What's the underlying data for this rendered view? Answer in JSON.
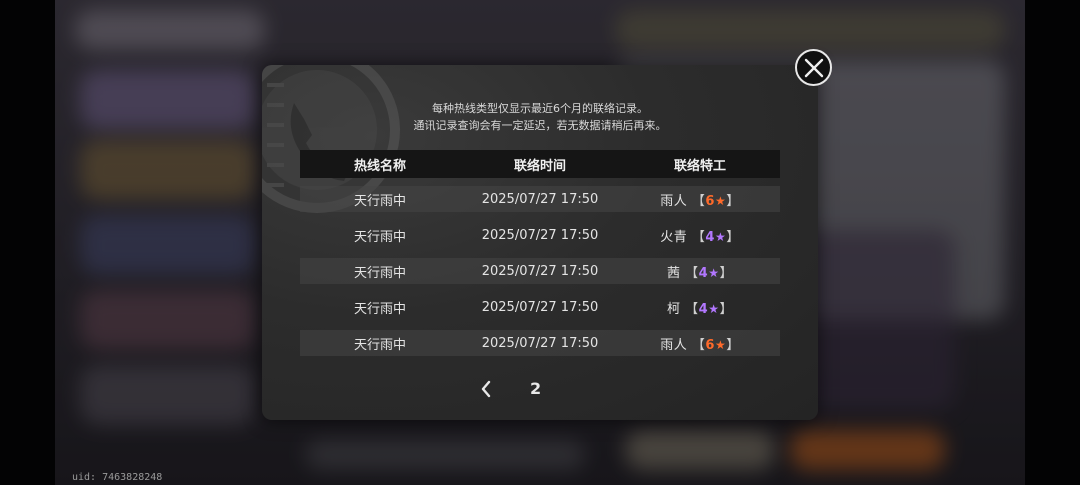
{
  "notice": {
    "line1": "每种热线类型仅显示最近6个月的联络记录。",
    "line2": "通讯记录查询会有一定延迟，若无数据请稍后再来。"
  },
  "table": {
    "headers": [
      "热线名称",
      "联络时间",
      "联络特工"
    ],
    "rows": [
      {
        "hotline": "天行雨中",
        "time": "2025/07/27 17:50",
        "agent": "雨人",
        "rank": "6",
        "rank_color": "#ff6a2a",
        "star": "★"
      },
      {
        "hotline": "天行雨中",
        "time": "2025/07/27 17:50",
        "agent": "火青",
        "rank": "4",
        "rank_color": "#b277ff",
        "star": "★"
      },
      {
        "hotline": "天行雨中",
        "time": "2025/07/27 17:50",
        "agent": "茜",
        "rank": "4",
        "rank_color": "#b277ff",
        "star": "★"
      },
      {
        "hotline": "天行雨中",
        "time": "2025/07/27 17:50",
        "agent": "柯",
        "rank": "4",
        "rank_color": "#b277ff",
        "star": "★"
      },
      {
        "hotline": "天行雨中",
        "time": "2025/07/27 17:50",
        "agent": "雨人",
        "rank": "6",
        "rank_color": "#ff6a2a",
        "star": "★"
      }
    ]
  },
  "pager": {
    "current_page": "2"
  },
  "brackets": {
    "open": "【",
    "close": "】"
  },
  "footer": {
    "uid": "uid: 7463828248"
  },
  "icons": {
    "close": "close-icon",
    "prev": "chevron-left-icon",
    "watermark": "phone-icon"
  }
}
